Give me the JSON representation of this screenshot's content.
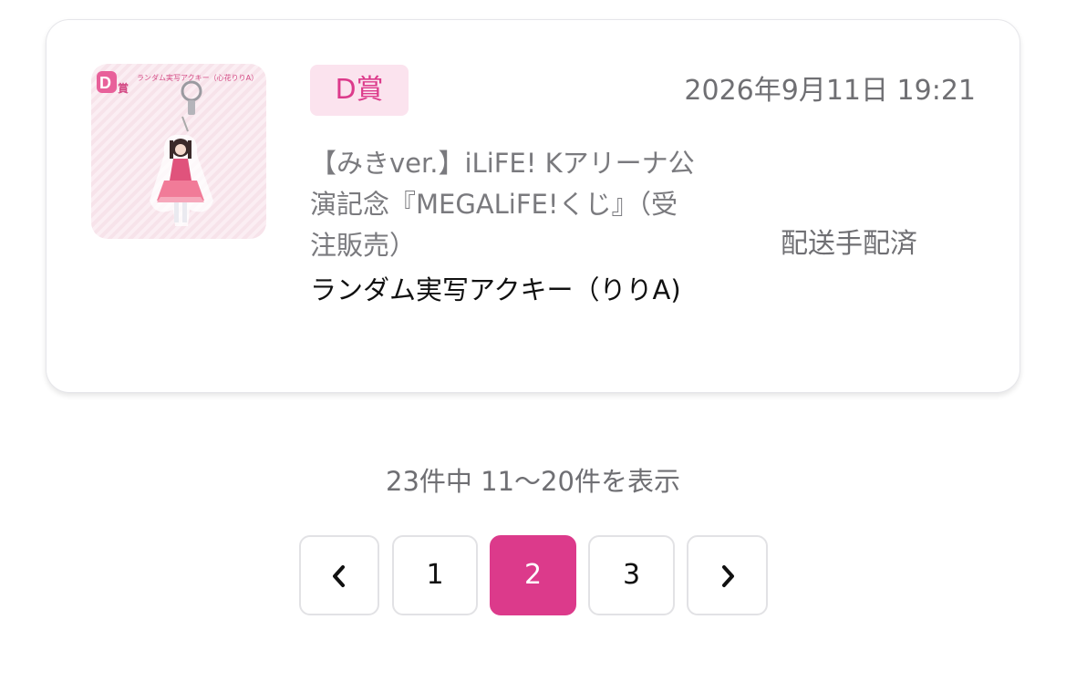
{
  "order": {
    "prize_badge": "D賞",
    "timestamp": "2026年9月11日 19:21",
    "product_title": "【みきver.】iLiFE! Kアリーナ公演記念『MEGALiFE!くじ』（受注販売）",
    "item_name": "ランダム実写アクキー（りりA)",
    "status": "配送手配済",
    "thumbnail": {
      "prize_mark": "D賞",
      "caption": "ランダム実写アクキー（心花りりA）"
    }
  },
  "pagination": {
    "summary": "23件中 11〜20件を表示",
    "prev_icon": "chevron-left-icon",
    "next_icon": "chevron-right-icon",
    "pages": [
      "1",
      "2",
      "3"
    ],
    "current_page": "2"
  },
  "colors": {
    "accent": "#dc3a8b",
    "badge_bg": "#fbe3ee",
    "muted_text": "#6f6f73",
    "border": "#e2e2e5"
  }
}
